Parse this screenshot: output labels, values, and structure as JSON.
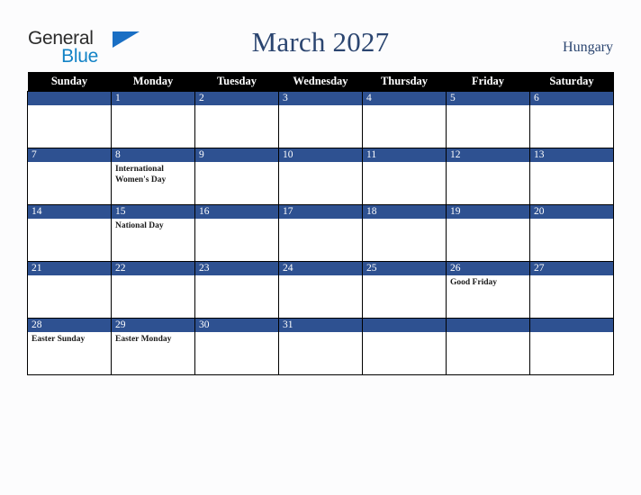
{
  "brand": {
    "name_part1": "General",
    "name_part2": "Blue",
    "triangle_color": "#1a6fc4",
    "blue_text_color": "#1383c6"
  },
  "header": {
    "title": "March 2027",
    "country": "Hungary",
    "title_color": "#2b4570"
  },
  "calendar": {
    "weekday_headers": [
      "Sunday",
      "Monday",
      "Tuesday",
      "Wednesday",
      "Thursday",
      "Friday",
      "Saturday"
    ],
    "header_background": "#000000",
    "daynum_band_color": "#2e5191",
    "weeks": [
      [
        {
          "day": "",
          "events": []
        },
        {
          "day": "1",
          "events": []
        },
        {
          "day": "2",
          "events": []
        },
        {
          "day": "3",
          "events": []
        },
        {
          "day": "4",
          "events": []
        },
        {
          "day": "5",
          "events": []
        },
        {
          "day": "6",
          "events": []
        }
      ],
      [
        {
          "day": "7",
          "events": []
        },
        {
          "day": "8",
          "events": [
            "International Women's Day"
          ]
        },
        {
          "day": "9",
          "events": []
        },
        {
          "day": "10",
          "events": []
        },
        {
          "day": "11",
          "events": []
        },
        {
          "day": "12",
          "events": []
        },
        {
          "day": "13",
          "events": []
        }
      ],
      [
        {
          "day": "14",
          "events": []
        },
        {
          "day": "15",
          "events": [
            "National Day"
          ]
        },
        {
          "day": "16",
          "events": []
        },
        {
          "day": "17",
          "events": []
        },
        {
          "day": "18",
          "events": []
        },
        {
          "day": "19",
          "events": []
        },
        {
          "day": "20",
          "events": []
        }
      ],
      [
        {
          "day": "21",
          "events": []
        },
        {
          "day": "22",
          "events": []
        },
        {
          "day": "23",
          "events": []
        },
        {
          "day": "24",
          "events": []
        },
        {
          "day": "25",
          "events": []
        },
        {
          "day": "26",
          "events": [
            "Good Friday"
          ]
        },
        {
          "day": "27",
          "events": []
        }
      ],
      [
        {
          "day": "28",
          "events": [
            "Easter Sunday"
          ]
        },
        {
          "day": "29",
          "events": [
            "Easter Monday"
          ]
        },
        {
          "day": "30",
          "events": []
        },
        {
          "day": "31",
          "events": []
        },
        {
          "day": "",
          "events": []
        },
        {
          "day": "",
          "events": []
        },
        {
          "day": "",
          "events": []
        }
      ]
    ]
  }
}
